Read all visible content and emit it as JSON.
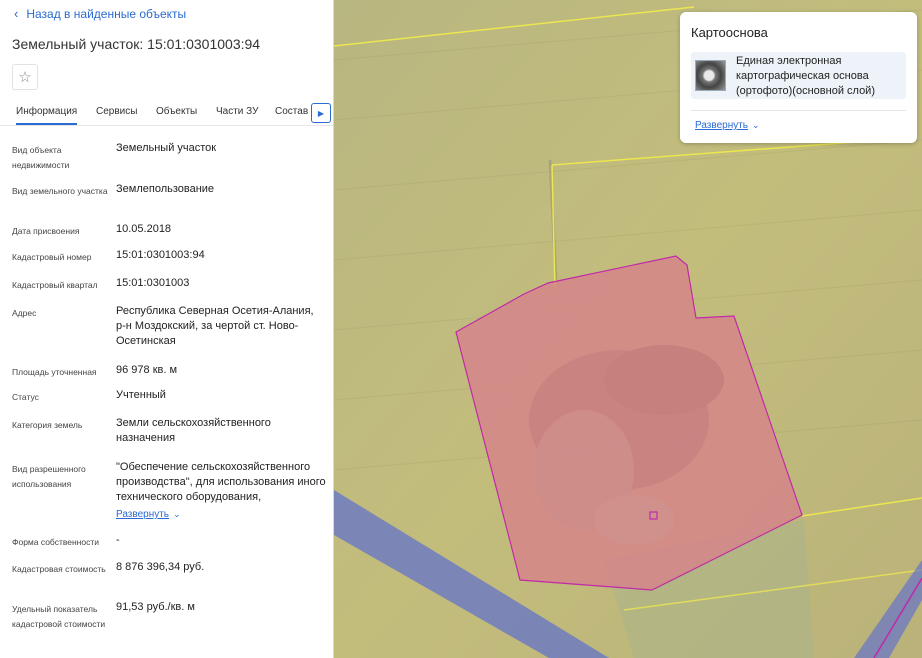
{
  "back_link": "Назад в найденные объекты",
  "title": "Земельный участок: 15:01:0301003:94",
  "favorite_icon": "star-outline-icon",
  "tabs": [
    {
      "label": "Информация",
      "active": true
    },
    {
      "label": "Сервисы",
      "active": false
    },
    {
      "label": "Объекты",
      "active": false
    },
    {
      "label": "Части ЗУ",
      "active": false
    },
    {
      "label": "Состав",
      "active": false
    }
  ],
  "tabs_next_icon": "chevron-right-icon",
  "properties": [
    {
      "label": "Вид объекта недвижимости",
      "value": "Земельный участок"
    },
    {
      "label": "Вид земельного участка",
      "value": "Землепользование"
    },
    {
      "label": "Дата присвоения",
      "value": "10.05.2018"
    },
    {
      "label": "Кадастровый номер",
      "value": "15:01:0301003:94"
    },
    {
      "label": "Кадастровый квартал",
      "value": "15:01:0301003"
    },
    {
      "label": "Адрес",
      "value": "Республика Северная Осетия-Алания, р-н Моздокский, за чертой ст. Ново-Осетинская"
    },
    {
      "label": "Площадь уточненная",
      "value": "96 978 кв. м"
    },
    {
      "label": "Статус",
      "value": "Учтенный"
    },
    {
      "label": "Категория земель",
      "value": "Земли сельскохозяйственного назначения"
    },
    {
      "label": "Вид разрешенного использования",
      "value": "\"Обеспечение сельскохозяйственного производства\", для использования иного технического оборудования,"
    },
    {
      "label": "Форма собственности",
      "value": "-"
    },
    {
      "label": "Кадастровая стоимость",
      "value": "8 876 396,34 руб."
    },
    {
      "label": "Удельный показатель кадастровой стоимости",
      "value": "91,53 руб./кв. м"
    }
  ],
  "expand_label": "Развернуть",
  "basemap": {
    "title": "Картооснова",
    "layer_name": "Единая электронная картографическая основа (ортофото)(основной слой)",
    "expand_label": "Развернуть"
  },
  "colors": {
    "accent": "#2a6ad3",
    "parcel_fill": "#d5858a",
    "parcel_stroke": "#c02aa8",
    "overlay_yellow": "#c9c07a",
    "road_blue": "#5d6fd0",
    "boundary_yellow": "#ece650"
  }
}
